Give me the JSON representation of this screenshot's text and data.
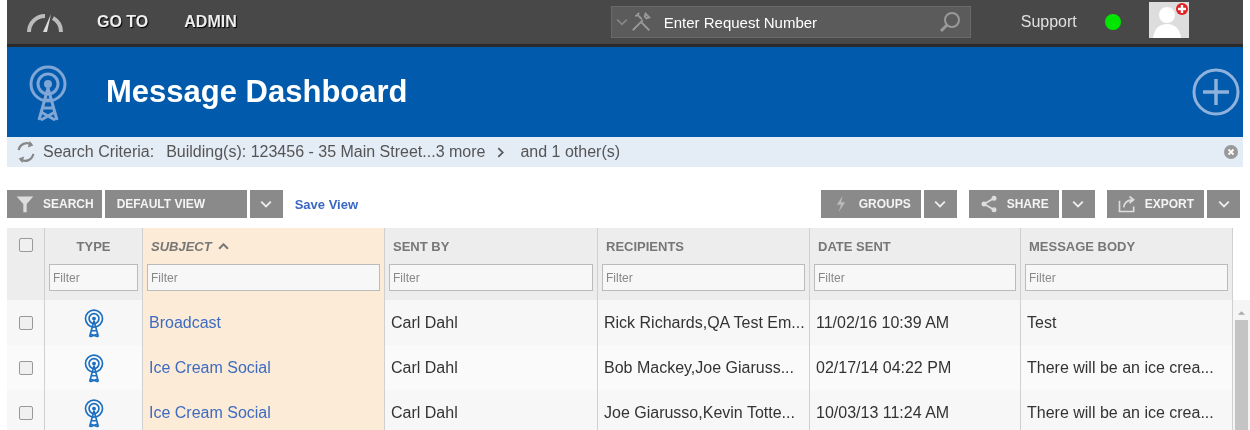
{
  "topbar": {
    "menu": [
      "GO TO",
      "ADMIN"
    ],
    "request_search": {
      "placeholder": "Enter Request Number"
    },
    "support": "Support",
    "online": true
  },
  "header": {
    "title": "Message Dashboard"
  },
  "criteria": {
    "label": "Search Criteria:",
    "buildings": "Building(s): 123456 - 35 Main Street...3 more",
    "others": "and 1 other(s)"
  },
  "toolbar": {
    "search": "SEARCH",
    "view": "DEFAULT VIEW",
    "save_view": "Save View",
    "groups": "GROUPS",
    "share": "SHARE",
    "export": "EXPORT"
  },
  "table": {
    "all_checked": false,
    "columns": [
      {
        "label": "TYPE",
        "sorted": false,
        "filter_placeholder": "Filter"
      },
      {
        "label": "SUBJECT",
        "sorted": true,
        "filter_placeholder": "Filter"
      },
      {
        "label": "SENT BY",
        "sorted": false,
        "filter_placeholder": "Filter"
      },
      {
        "label": "RECIPIENTS",
        "sorted": false,
        "filter_placeholder": "Filter"
      },
      {
        "label": "DATE SENT",
        "sorted": false,
        "filter_placeholder": "Filter"
      },
      {
        "label": "MESSAGE BODY",
        "sorted": false,
        "filter_placeholder": "Filter"
      }
    ],
    "rows": [
      {
        "checked": false,
        "subject": "Broadcast",
        "sent_by": "Carl Dahl",
        "recipients": "Rick Richards,QA Test Em...",
        "date_sent": "11/02/16 10:39 AM",
        "message_body": "Test"
      },
      {
        "checked": false,
        "subject": "Ice Cream Social",
        "sent_by": "Carl Dahl",
        "recipients": "Bob Mackey,Joe Giaruss...",
        "date_sent": "02/17/14 04:22 PM",
        "message_body": "There will be an ice crea..."
      },
      {
        "checked": false,
        "subject": "Ice Cream Social",
        "sent_by": "Carl Dahl",
        "recipients": "Joe Giarusso,Kevin Totte...",
        "date_sent": "10/03/13 11:24 AM",
        "message_body": "There will be an ice crea..."
      }
    ]
  }
}
